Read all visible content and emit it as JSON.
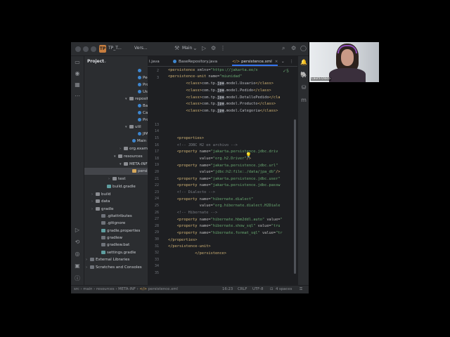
{
  "titlebar": {
    "project_badge": "TP",
    "project_name": "TP_T...",
    "vcs": "Vers...",
    "run_config": "Main"
  },
  "project_panel": {
    "header": "Project",
    "items": [
      {
        "label": "",
        "kind": "class",
        "indent": 70,
        "caret": ""
      },
      {
        "label": "Pedi",
        "kind": "class",
        "indent": 70,
        "caret": ""
      },
      {
        "label": "Prod",
        "kind": "class",
        "indent": 70,
        "caret": ""
      },
      {
        "label": "Usua",
        "kind": "class",
        "indent": 70,
        "caret": ""
      },
      {
        "label": "reposito",
        "kind": "folder",
        "indent": 58,
        "caret": "▾"
      },
      {
        "label": "Base",
        "kind": "class",
        "indent": 70,
        "caret": ""
      },
      {
        "label": "Cate",
        "kind": "class",
        "indent": 70,
        "caret": ""
      },
      {
        "label": "Prod",
        "kind": "class",
        "indent": 70,
        "caret": ""
      },
      {
        "label": "util",
        "kind": "folder",
        "indent": 58,
        "caret": "▾"
      },
      {
        "label": "JPAt",
        "kind": "class",
        "indent": 70,
        "caret": ""
      },
      {
        "label": "Main",
        "kind": "class",
        "indent": 62,
        "caret": ""
      },
      {
        "label": "org.examp",
        "kind": "folder",
        "indent": 50,
        "caret": "›"
      },
      {
        "label": "resources",
        "kind": "folder",
        "indent": 42,
        "caret": "▾"
      },
      {
        "label": "META-INF",
        "kind": "folder",
        "indent": 50,
        "caret": "▾"
      },
      {
        "label": "persist",
        "kind": "xml",
        "indent": 62,
        "caret": "",
        "selected": true
      },
      {
        "label": "test",
        "kind": "folder",
        "indent": 34,
        "caret": "›"
      },
      {
        "label": "build.gradle",
        "kind": "gradle",
        "indent": 26,
        "caret": ""
      },
      {
        "label": "build",
        "kind": "folder",
        "indent": 10,
        "caret": "›"
      },
      {
        "label": "data",
        "kind": "folder",
        "indent": 10,
        "caret": "›"
      },
      {
        "label": "gradle",
        "kind": "folder",
        "indent": 10,
        "caret": "›"
      },
      {
        "label": ".gitattributes",
        "kind": "lib",
        "indent": 18,
        "caret": ""
      },
      {
        "label": ".gitignore",
        "kind": "lib",
        "indent": 18,
        "caret": ""
      },
      {
        "label": "gradle.properties",
        "kind": "gradle",
        "indent": 18,
        "caret": ""
      },
      {
        "label": "gradlew",
        "kind": "lib",
        "indent": 18,
        "caret": ""
      },
      {
        "label": "gradlew.bat",
        "kind": "lib",
        "indent": 18,
        "caret": ""
      },
      {
        "label": "settings.gradle",
        "kind": "gradle",
        "indent": 18,
        "caret": ""
      },
      {
        "label": "External Libraries",
        "kind": "lib",
        "indent": 2,
        "caret": "›"
      },
      {
        "label": "Scratches and Consoles",
        "kind": "lib",
        "indent": 2,
        "caret": "›"
      }
    ]
  },
  "tabs": [
    {
      "label": "l.java",
      "active": false
    },
    {
      "label": "BaseRepository.java",
      "active": false
    },
    {
      "label": "persistence.xml",
      "active": true
    }
  ],
  "inspection": "✓5",
  "line_numbers": [
    "2",
    "3",
    "",
    "",
    "",
    "",
    "",
    "",
    "13",
    "14",
    "15",
    "16",
    "17",
    "18",
    "19",
    "20",
    "21",
    "22",
    "23",
    "24",
    "25",
    "26",
    "27",
    "28",
    "29",
    "30",
    "31",
    "32",
    "33",
    "34",
    "35"
  ],
  "code_lines": [
    [
      {
        "t": "<persistence ",
        "c": "k-tag"
      },
      {
        "t": "xmlns=",
        "c": "k-attr"
      },
      {
        "t": "\"https://jakarta.ee/x",
        "c": "k-val"
      }
    ],
    [
      {
        "t": "<persistence-unit ",
        "c": "k-tag"
      },
      {
        "t": "name=",
        "c": "k-attr"
      },
      {
        "t": "\"miunidad\"",
        "c": "k-val"
      }
    ],
    [
      {
        "t": "        <class>",
        "c": "k-tag"
      },
      {
        "t": "com.tp.",
        "c": "k-txt"
      },
      {
        "t": "jpa",
        "c": "k-hl"
      },
      {
        "t": ".model.Usuario",
        "c": "k-txt"
      },
      {
        "t": "</class>",
        "c": "k-tag"
      }
    ],
    [
      {
        "t": "        <class>",
        "c": "k-tag"
      },
      {
        "t": "com.tp.",
        "c": "k-txt"
      },
      {
        "t": "jpa",
        "c": "k-hl"
      },
      {
        "t": ".model.Pedido",
        "c": "k-txt"
      },
      {
        "t": "</class>",
        "c": "k-tag"
      }
    ],
    [
      {
        "t": "        <class>",
        "c": "k-tag"
      },
      {
        "t": "com.tp.",
        "c": "k-txt"
      },
      {
        "t": "jpa",
        "c": "k-hl"
      },
      {
        "t": ".model.DetallePedido",
        "c": "k-txt"
      },
      {
        "t": "</cla",
        "c": "k-tag"
      }
    ],
    [
      {
        "t": "        <class>",
        "c": "k-tag"
      },
      {
        "t": "com.tp.",
        "c": "k-txt"
      },
      {
        "t": "jpa",
        "c": "k-hl"
      },
      {
        "t": ".model.Producto",
        "c": "k-txt"
      },
      {
        "t": "</class>",
        "c": "k-tag"
      }
    ],
    [
      {
        "t": "        <class>",
        "c": "k-tag"
      },
      {
        "t": "com.tp.",
        "c": "k-txt"
      },
      {
        "t": "jpa",
        "c": "k-hl"
      },
      {
        "t": ".model.Categoria",
        "c": "k-txt"
      },
      {
        "t": "</class>",
        "c": "k-tag"
      }
    ],
    [],
    [],
    [
      {
        "t": "    <properties>",
        "c": "k-tag"
      }
    ],
    [
      {
        "t": "    <!-- JDBC H2 en archivo -->",
        "c": "k-com"
      }
    ],
    [
      {
        "t": "    <property ",
        "c": "k-tag"
      },
      {
        "t": "name=",
        "c": "k-attr"
      },
      {
        "t": "\"jakarta.persistence.jdbc.driv",
        "c": "k-val"
      }
    ],
    [
      {
        "t": "              value=",
        "c": "k-attr"
      },
      {
        "t": "\"org.h2.Driver\"",
        "c": "k-val"
      },
      {
        "t": "/>",
        "c": "k-tag"
      }
    ],
    [
      {
        "t": "    <property ",
        "c": "k-tag"
      },
      {
        "t": "name=",
        "c": "k-attr"
      },
      {
        "t": "\"jakarta.persistence.jdbc.url\"",
        "c": "k-val"
      }
    ],
    [
      {
        "t": "              value=",
        "c": "k-attr"
      },
      {
        "t": "\"jdbc:h2:file:./data/jpa_db\"",
        "c": "k-val"
      },
      {
        "t": "/>",
        "c": "k-tag"
      }
    ],
    [
      {
        "t": "    <property ",
        "c": "k-tag"
      },
      {
        "t": "name=",
        "c": "k-attr"
      },
      {
        "t": "\"jakarta.persistence.jdbc.user\"",
        "c": "k-val"
      }
    ],
    [
      {
        "t": "    <property ",
        "c": "k-tag"
      },
      {
        "t": "name=",
        "c": "k-attr"
      },
      {
        "t": "\"jakarta.persistence.jdbc.passw",
        "c": "k-val"
      }
    ],
    [
      {
        "t": "    <!-- Dialecto -->",
        "c": "k-com"
      }
    ],
    [
      {
        "t": "    <property ",
        "c": "k-tag"
      },
      {
        "t": "name=",
        "c": "k-attr"
      },
      {
        "t": "\"hibernate.dialect\"",
        "c": "k-val"
      }
    ],
    [
      {
        "t": "              value=",
        "c": "k-attr"
      },
      {
        "t": "\"org.hibernate.dialect.H2Diale",
        "c": "k-val"
      }
    ],
    [
      {
        "t": "    <!-- Hibernate -->",
        "c": "k-com"
      }
    ],
    [
      {
        "t": "    <property ",
        "c": "k-tag"
      },
      {
        "t": "name=",
        "c": "k-attr"
      },
      {
        "t": "\"hibernate.hbm2ddl.auto\" ",
        "c": "k-val"
      },
      {
        "t": "value=",
        "c": "k-attr"
      },
      {
        "t": "\"",
        "c": "k-val"
      }
    ],
    [
      {
        "t": "    <property ",
        "c": "k-tag"
      },
      {
        "t": "name=",
        "c": "k-attr"
      },
      {
        "t": "\"hibernate.show_sql\" ",
        "c": "k-val"
      },
      {
        "t": "value=",
        "c": "k-attr"
      },
      {
        "t": "\"tru",
        "c": "k-val"
      }
    ],
    [
      {
        "t": "    <property ",
        "c": "k-tag"
      },
      {
        "t": "name=",
        "c": "k-attr"
      },
      {
        "t": "\"hibernate.format_sql\" ",
        "c": "k-val"
      },
      {
        "t": "value=",
        "c": "k-attr"
      },
      {
        "t": "\"tr",
        "c": "k-val"
      }
    ],
    [
      {
        "t": "</properties>",
        "c": "k-tag"
      }
    ],
    [
      {
        "t": "</persistence-unit>",
        "c": "k-tag"
      }
    ],
    [
      {
        "t": "            </persistence>",
        "c": "k-tag"
      }
    ]
  ],
  "statusbar": {
    "path": [
      "src",
      "main",
      "resources",
      "META-INF",
      "persistence.xml"
    ],
    "position": "16:23",
    "line_sep": "CRLF",
    "encoding": "UTF-8",
    "indent": "4 spaces"
  },
  "webcam": {
    "name": "Laura Diaco"
  },
  "colors": {
    "accent": "#3574f0",
    "ide_bg": "#1e1f22",
    "panel_bg": "#2b2d30"
  }
}
